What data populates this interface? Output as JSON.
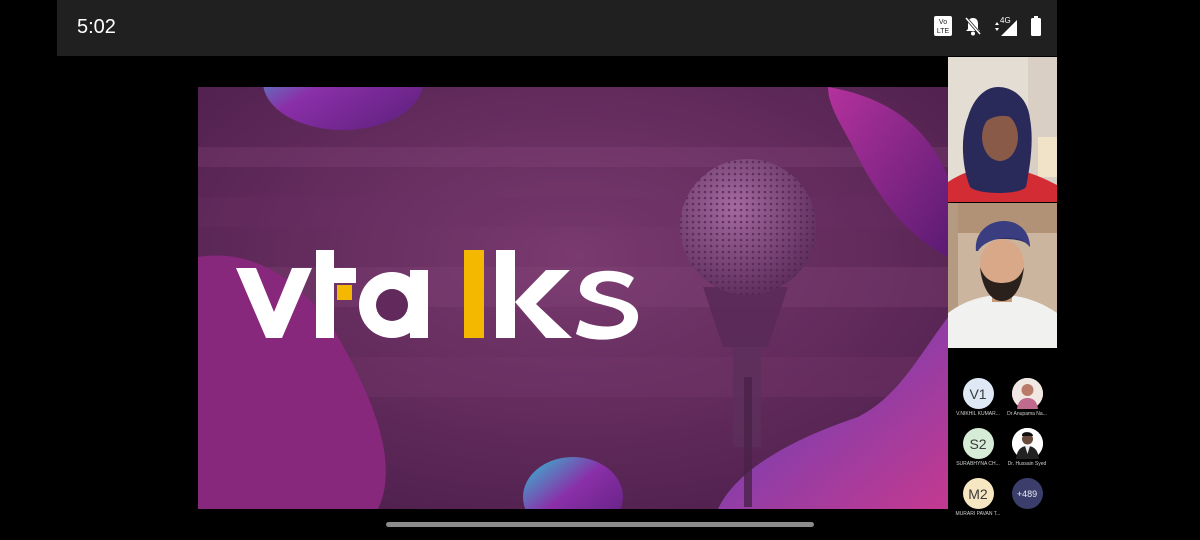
{
  "status_bar": {
    "time": "5:02",
    "icons": [
      "volte-icon",
      "bell-off-icon",
      "signal-4g-icon",
      "battery-icon"
    ],
    "volte_label": "Vo LTE",
    "network_label": "4G"
  },
  "presentation": {
    "logo_text": "vtalks",
    "accent_color": "#f5b800",
    "background_color": "#61295c"
  },
  "video_tiles": [
    {
      "name": "presenter-tile-1"
    },
    {
      "name": "presenter-tile-2"
    }
  ],
  "participants": [
    {
      "initials": "V1",
      "name": "V.NIKHIL KUMAR...",
      "color": "#dfe9f5"
    },
    {
      "initials": "",
      "name": "Dr Anupama Na...",
      "color": "#c98ca0",
      "photo": true
    },
    {
      "initials": "S2",
      "name": "SURABHYNA CH...",
      "color": "#d6ecd6"
    },
    {
      "initials": "",
      "name": "Dr. Hussain Syed",
      "color": "#d8d8d8",
      "photo": true
    },
    {
      "initials": "M2",
      "name": "MURARI PAVAN T...",
      "color": "#f6e7c2"
    },
    {
      "initials": "+489",
      "name": "",
      "color": "#3b3e6b"
    }
  ]
}
